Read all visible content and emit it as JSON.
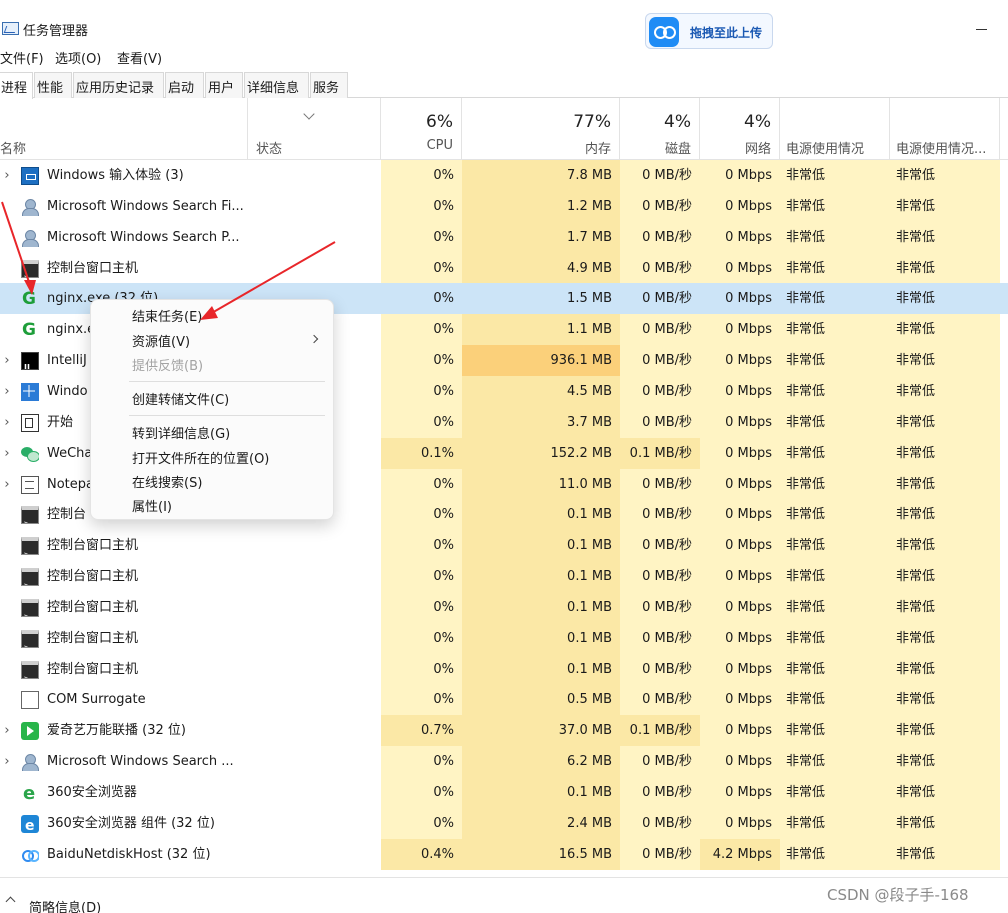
{
  "app": {
    "title": "任务管理器",
    "upload_button": "拖拽至此上传"
  },
  "menu": [
    "文件(F)",
    "选项(O)",
    "查看(V)"
  ],
  "tabs": [
    "进程",
    "性能",
    "应用历史记录",
    "启动",
    "用户",
    "详细信息",
    "服务"
  ],
  "header": {
    "name": "名称",
    "status": "状态",
    "cpu_pct": "6%",
    "cpu": "CPU",
    "mem_pct": "77%",
    "mem": "内存",
    "disk_pct": "4%",
    "disk": "磁盘",
    "net_pct": "4%",
    "net": "网络",
    "power": "电源使用情况",
    "power_trend": "电源使用情况..."
  },
  "processes": [
    {
      "expand": "›",
      "icon": "keyboard-icon",
      "name": "Windows 输入体验 (3)",
      "leaf": true,
      "cpu": "0%",
      "mem": "7.8 MB",
      "disk": "0 MB/秒",
      "net": "0 Mbps",
      "power": "非常低",
      "power_trend": "非常低"
    },
    {
      "expand": "",
      "icon": "search-user-icon",
      "name": "Microsoft Windows Search Fi...",
      "cpu": "0%",
      "mem": "1.2 MB",
      "disk": "0 MB/秒",
      "net": "0 Mbps",
      "power": "非常低",
      "power_trend": "非常低"
    },
    {
      "expand": "",
      "icon": "search-user-icon",
      "name": "Microsoft Windows Search P...",
      "cpu": "0%",
      "mem": "1.7 MB",
      "disk": "0 MB/秒",
      "net": "0 Mbps",
      "power": "非常低",
      "power_trend": "非常低"
    },
    {
      "expand": "",
      "icon": "console-icon",
      "name": "控制台窗口主机",
      "cpu": "0%",
      "mem": "4.9 MB",
      "disk": "0 MB/秒",
      "net": "0 Mbps",
      "power": "非常低",
      "power_trend": "非常低"
    },
    {
      "expand": "",
      "icon": "nginx-icon",
      "name": "nginx.exe (32 位)",
      "selected": true,
      "cpu": "0%",
      "mem": "1.5 MB",
      "disk": "0 MB/秒",
      "net": "0 Mbps",
      "power": "非常低",
      "power_trend": "非常低"
    },
    {
      "expand": "",
      "icon": "nginx-icon",
      "name": "nginx.e",
      "cpu": "0%",
      "mem": "1.1 MB",
      "disk": "0 MB/秒",
      "net": "0 Mbps",
      "power": "非常低",
      "power_trend": "非常低"
    },
    {
      "expand": "›",
      "icon": "intellij-icon",
      "name": "IntelliJ",
      "cpu": "0%",
      "mem": "936.1 MB",
      "hot": true,
      "disk": "0 MB/秒",
      "net": "0 Mbps",
      "power": "非常低",
      "power_trend": "非常低"
    },
    {
      "expand": "›",
      "icon": "windows-icon",
      "name": "Windo",
      "cpu": "0%",
      "mem": "4.5 MB",
      "disk": "0 MB/秒",
      "net": "0 Mbps",
      "power": "非常低",
      "power_trend": "非常低"
    },
    {
      "expand": "›",
      "icon": "start-icon",
      "name": "开始",
      "cpu": "0%",
      "mem": "3.7 MB",
      "disk": "0 MB/秒",
      "net": "0 Mbps",
      "power": "非常低",
      "power_trend": "非常低"
    },
    {
      "expand": "›",
      "icon": "wechat-icon",
      "name": "WeCha",
      "cpu": "0.1%",
      "cpu_active": true,
      "mem": "152.2 MB",
      "disk": "0.1 MB/秒",
      "disk_active": true,
      "net": "0 Mbps",
      "power": "非常低",
      "power_trend": "非常低"
    },
    {
      "expand": "›",
      "icon": "notepad-icon",
      "name": "Notepa",
      "cpu": "0%",
      "mem": "11.0 MB",
      "disk": "0 MB/秒",
      "net": "0 Mbps",
      "power": "非常低",
      "power_trend": "非常低"
    },
    {
      "expand": "",
      "icon": "console-icon",
      "name": "控制台",
      "cpu": "0%",
      "mem": "0.1 MB",
      "disk": "0 MB/秒",
      "net": "0 Mbps",
      "power": "非常低",
      "power_trend": "非常低"
    },
    {
      "expand": "",
      "icon": "console-icon",
      "name": "控制台窗口主机",
      "cpu": "0%",
      "mem": "0.1 MB",
      "disk": "0 MB/秒",
      "net": "0 Mbps",
      "power": "非常低",
      "power_trend": "非常低"
    },
    {
      "expand": "",
      "icon": "console-icon",
      "name": "控制台窗口主机",
      "cpu": "0%",
      "mem": "0.1 MB",
      "disk": "0 MB/秒",
      "net": "0 Mbps",
      "power": "非常低",
      "power_trend": "非常低"
    },
    {
      "expand": "",
      "icon": "console-icon",
      "name": "控制台窗口主机",
      "cpu": "0%",
      "mem": "0.1 MB",
      "disk": "0 MB/秒",
      "net": "0 Mbps",
      "power": "非常低",
      "power_trend": "非常低"
    },
    {
      "expand": "",
      "icon": "console-icon",
      "name": "控制台窗口主机",
      "cpu": "0%",
      "mem": "0.1 MB",
      "disk": "0 MB/秒",
      "net": "0 Mbps",
      "power": "非常低",
      "power_trend": "非常低"
    },
    {
      "expand": "",
      "icon": "console-icon",
      "name": "控制台窗口主机",
      "cpu": "0%",
      "mem": "0.1 MB",
      "disk": "0 MB/秒",
      "net": "0 Mbps",
      "power": "非常低",
      "power_trend": "非常低"
    },
    {
      "expand": "",
      "icon": "com-icon",
      "name": "COM Surrogate",
      "cpu": "0%",
      "mem": "0.5 MB",
      "disk": "0 MB/秒",
      "net": "0 Mbps",
      "power": "非常低",
      "power_trend": "非常低"
    },
    {
      "expand": "›",
      "icon": "iqiyi-icon",
      "name": "爱奇艺万能联播 (32 位)",
      "cpu": "0.7%",
      "cpu_active": true,
      "mem": "37.0 MB",
      "disk": "0.1 MB/秒",
      "disk_active": true,
      "net": "0 Mbps",
      "power": "非常低",
      "power_trend": "非常低"
    },
    {
      "expand": "›",
      "icon": "search-user-icon",
      "name": "Microsoft Windows Search ...",
      "cpu": "0%",
      "mem": "6.2 MB",
      "disk": "0 MB/秒",
      "net": "0 Mbps",
      "power": "非常低",
      "power_trend": "非常低"
    },
    {
      "expand": "",
      "icon": "browser-360-icon",
      "name": "360安全浏览器",
      "cpu": "0%",
      "mem": "0.1 MB",
      "disk": "0 MB/秒",
      "net": "0 Mbps",
      "power": "非常低",
      "power_trend": "非常低"
    },
    {
      "expand": "",
      "icon": "browser-360-component-icon",
      "name": "360安全浏览器 组件 (32 位)",
      "cpu": "0%",
      "mem": "2.4 MB",
      "disk": "0 MB/秒",
      "net": "0 Mbps",
      "power": "非常低",
      "power_trend": "非常低"
    },
    {
      "expand": "",
      "icon": "baidu-netdisk-icon",
      "name": "BaiduNetdiskHost (32 位)",
      "cpu": "0.4%",
      "cpu_active": true,
      "mem": "16.5 MB",
      "disk": "0 MB/秒",
      "net": "4.2 Mbps",
      "net_active": true,
      "power": "非常低",
      "power_trend": "非常低"
    }
  ],
  "context_menu": {
    "end_task": "结束任务(E)",
    "resource_values": "资源值(V)",
    "feedback": "提供反馈(B)",
    "create_dump": "创建转储文件(C)",
    "go_to_details": "转到详细信息(G)",
    "open_file_location": "打开文件所在的位置(O)",
    "search_online": "在线搜索(S)",
    "properties": "属性(I)"
  },
  "footer": {
    "fewer_details": "简略信息(D)"
  },
  "watermark": "CSDN @段子手-168",
  "colors": {
    "selected_row": "#cce4f7",
    "heat_light": "#fff4c4",
    "heat_mid": "#fbe8a6",
    "heat_hot": "#fbd07a",
    "arrow": "#e8262a"
  }
}
